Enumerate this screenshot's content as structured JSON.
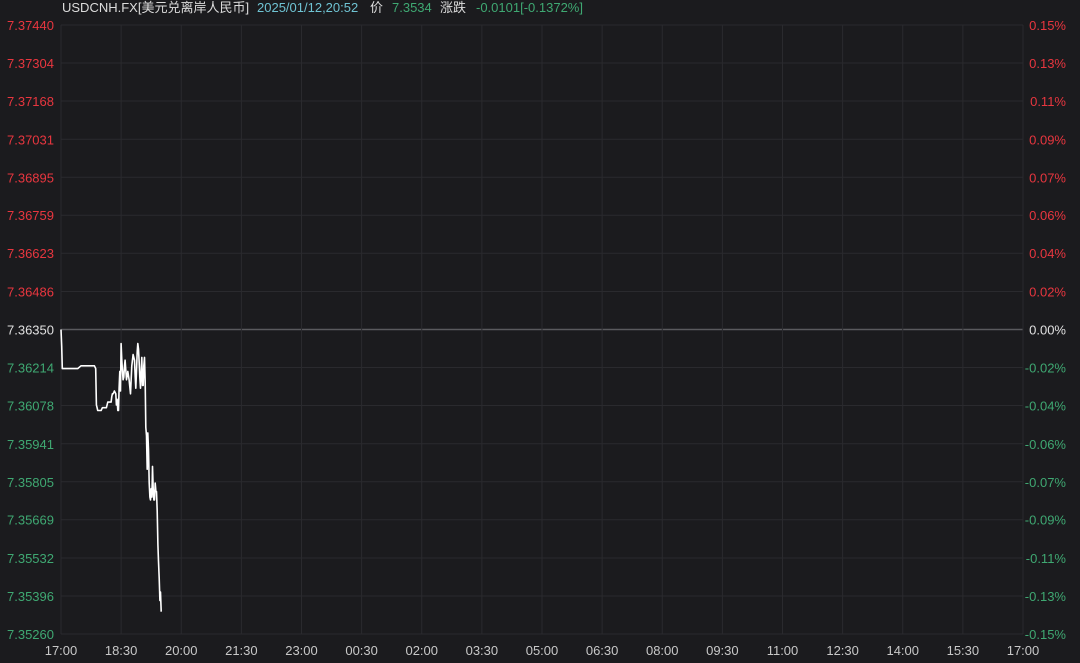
{
  "header": {
    "symbol": "USDCNH.FX[美元兑离岸人民币]",
    "datetime": "2025/01/12,20:52",
    "price_label": "价",
    "price": "7.3534",
    "change_label": "涨跌",
    "change": "-0.0101[-0.1372%]"
  },
  "colors": {
    "background": "#1b1b1e",
    "grid": "#2a2a2e",
    "baseline": "#5a5a5e",
    "line": "#ffffff",
    "up": "#e8363f",
    "down": "#3fa872",
    "neutral": "#e0e0e0",
    "header_text": "#dcdcdc",
    "datetime": "#6fc3d3"
  },
  "chart_data": {
    "type": "line",
    "title": "",
    "xlabel": "",
    "ylabel": "",
    "prev_close": 7.3635,
    "ylim": [
      7.3526,
      7.3744
    ],
    "y_ticks": [
      "7.37440",
      "7.37304",
      "7.37168",
      "7.37031",
      "7.36895",
      "7.36759",
      "7.36623",
      "7.36486",
      "7.36350",
      "7.36214",
      "7.36078",
      "7.35941",
      "7.35805",
      "7.35669",
      "7.35532",
      "7.35396",
      "7.35260"
    ],
    "y_tick_values": [
      7.3744,
      7.37304,
      7.37168,
      7.37031,
      7.36895,
      7.36759,
      7.36623,
      7.36486,
      7.3635,
      7.36214,
      7.36078,
      7.35941,
      7.35805,
      7.35669,
      7.35532,
      7.35396,
      7.3526
    ],
    "pct_ticks": [
      "0.15%",
      "0.13%",
      "0.11%",
      "0.09%",
      "0.07%",
      "0.06%",
      "0.04%",
      "0.02%",
      "0.00%",
      "-0.02%",
      "-0.04%",
      "-0.06%",
      "-0.07%",
      "-0.09%",
      "-0.11%",
      "-0.13%",
      "-0.15%"
    ],
    "x_ticks": [
      "17:00",
      "18:30",
      "20:00",
      "21:30",
      "23:00",
      "00:30",
      "02:00",
      "03:30",
      "05:00",
      "06:30",
      "08:00",
      "09:30",
      "11:00",
      "12:30",
      "14:00",
      "15:30",
      "17:00"
    ],
    "x_tick_minutes": [
      0,
      90,
      180,
      270,
      360,
      450,
      540,
      630,
      720,
      810,
      900,
      990,
      1080,
      1170,
      1260,
      1350,
      1440
    ],
    "series": [
      {
        "x": [
          0,
          1,
          2,
          5,
          10,
          15,
          18,
          22,
          25,
          30,
          40,
          50,
          52,
          53,
          54,
          55,
          56,
          57,
          60,
          62,
          64,
          66,
          68,
          70,
          75,
          76,
          77,
          78,
          80,
          82,
          83,
          84,
          85,
          86,
          87,
          88,
          89,
          90,
          91,
          92,
          93,
          94,
          95,
          96,
          98,
          100,
          102,
          104,
          106,
          108,
          110,
          111,
          112,
          113,
          114,
          115,
          116,
          117,
          118,
          119,
          120,
          121,
          122,
          123,
          124,
          125,
          126,
          127,
          128,
          129,
          130,
          131,
          132,
          133,
          134,
          135,
          136,
          137,
          138,
          139,
          140,
          141,
          142,
          143,
          144,
          145,
          146,
          147,
          148,
          149,
          150
        ],
        "y": [
          7.3635,
          7.3629,
          7.3621,
          7.3621,
          7.3621,
          7.3621,
          7.3621,
          7.3621,
          7.3621,
          7.3622,
          7.3622,
          7.3622,
          7.3621,
          7.3608,
          7.3607,
          7.3606,
          7.3606,
          7.3606,
          7.3606,
          7.3607,
          7.3607,
          7.3607,
          7.3607,
          7.3609,
          7.3609,
          7.3611,
          7.3612,
          7.3612,
          7.3613,
          7.3612,
          7.3608,
          7.361,
          7.3606,
          7.3606,
          7.3614,
          7.362,
          7.3613,
          7.363,
          7.3624,
          7.362,
          7.3617,
          7.3618,
          7.3622,
          7.3624,
          7.3617,
          7.362,
          7.3617,
          7.3612,
          7.3622,
          7.3626,
          7.3624,
          7.3618,
          7.3614,
          7.362,
          7.3627,
          7.363,
          7.3628,
          7.3623,
          7.3618,
          7.3614,
          7.362,
          7.3625,
          7.3615,
          7.3615,
          7.3622,
          7.3625,
          7.3616,
          7.36,
          7.3597,
          7.3585,
          7.3598,
          7.3592,
          7.358,
          7.3575,
          7.3574,
          7.3578,
          7.3575,
          7.3586,
          7.3578,
          7.3574,
          7.3574,
          7.358,
          7.3577,
          7.3577,
          7.357,
          7.3558,
          7.3552,
          7.3546,
          7.3538,
          7.3541,
          7.3534
        ]
      }
    ]
  }
}
